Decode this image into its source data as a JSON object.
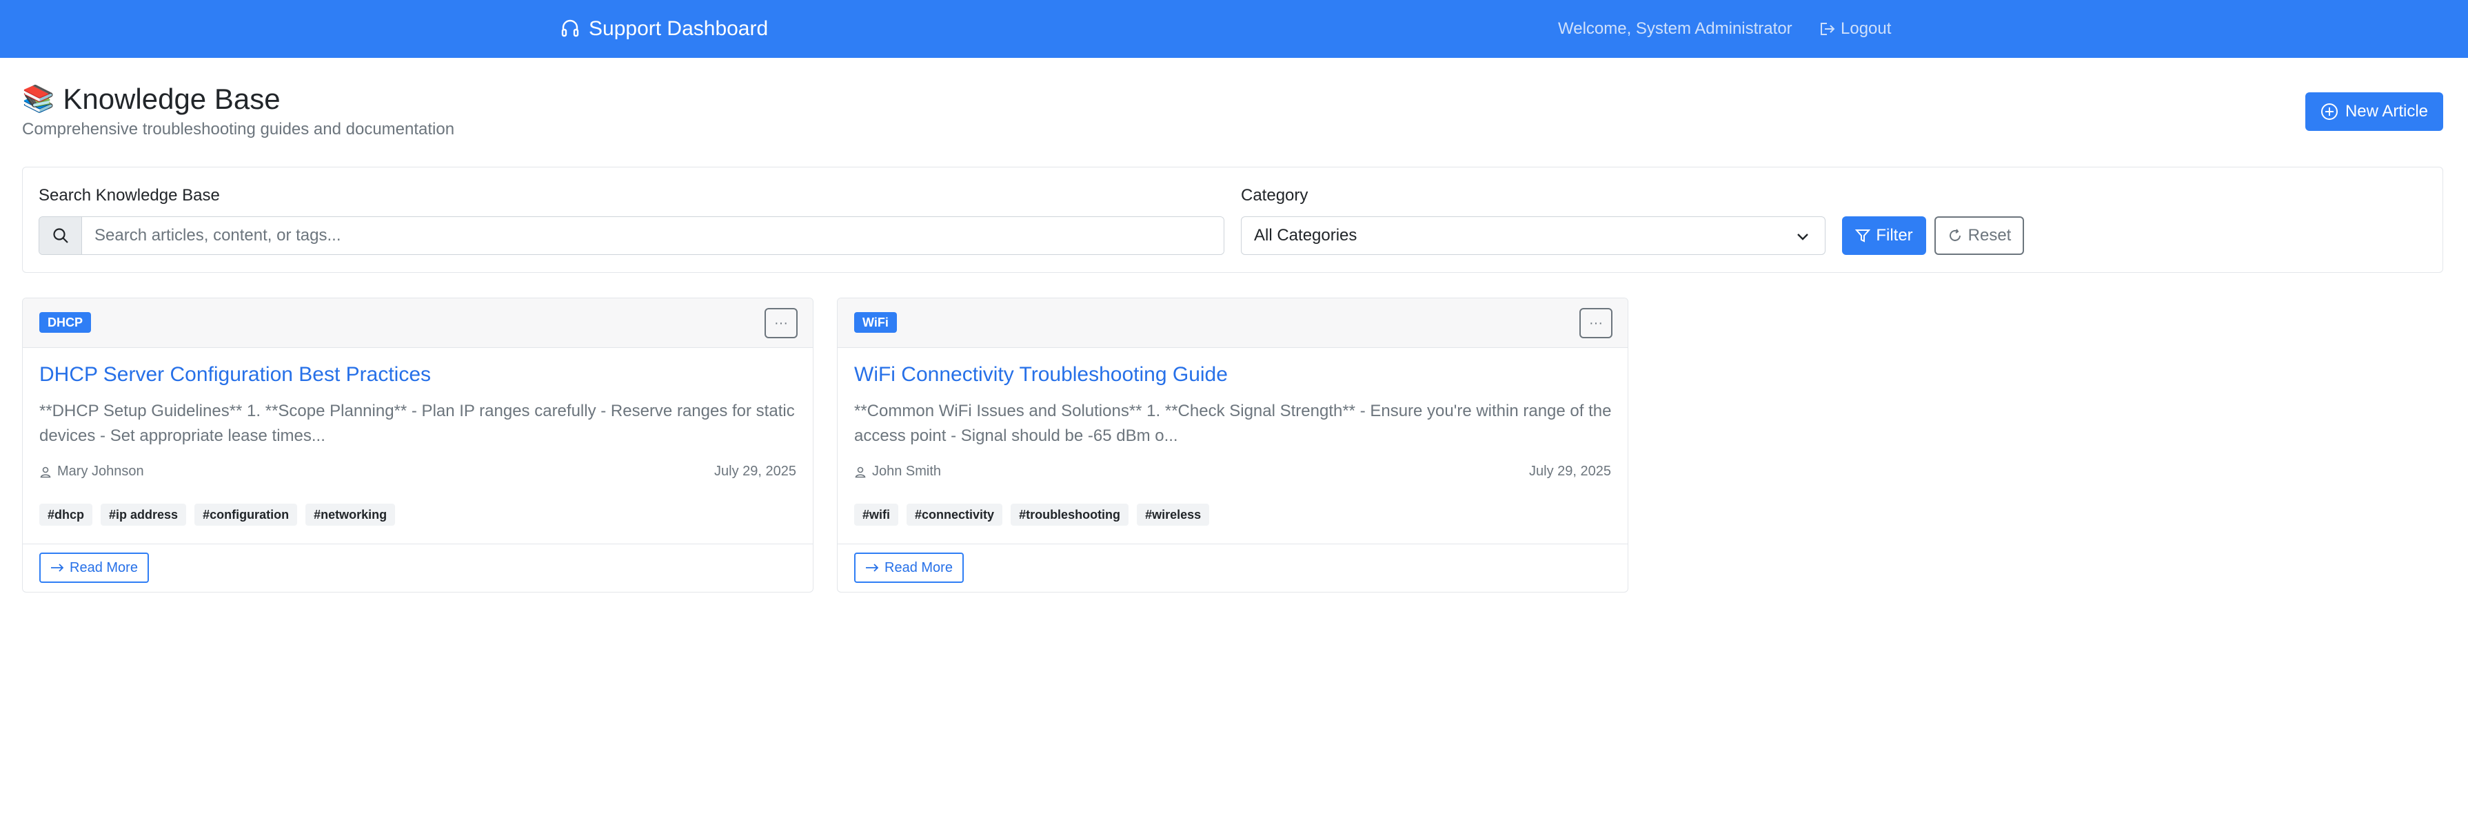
{
  "navbar": {
    "brand": "Support Dashboard",
    "brand_icon": "headset-icon",
    "welcome": "Welcome, System Administrator",
    "logout_label": "Logout"
  },
  "header": {
    "icon": "books-emoji",
    "title": "Knowledge Base",
    "subtitle": "Comprehensive troubleshooting guides and documentation",
    "new_article_label": "New Article"
  },
  "filters": {
    "search_label": "Search Knowledge Base",
    "search_placeholder": "Search articles, content, or tags...",
    "search_value": "",
    "category_label": "Category",
    "category_selected": "All Categories",
    "filter_label": "Filter",
    "reset_label": "Reset"
  },
  "articles": [
    {
      "category": "DHCP",
      "title": "DHCP Server Configuration Best Practices",
      "excerpt": "**DHCP Setup Guidelines** 1. **Scope Planning** - Plan IP ranges carefully - Reserve ranges for static devices - Set appropriate lease times...",
      "author": "Mary Johnson",
      "date": "July 29, 2025",
      "tags": [
        "#dhcp",
        "#ip address",
        "#configuration",
        "#networking"
      ],
      "read_more": "Read More"
    },
    {
      "category": "WiFi",
      "title": "WiFi Connectivity Troubleshooting Guide",
      "excerpt": "**Common WiFi Issues and Solutions** 1. **Check Signal Strength** - Ensure you're within range of the access point - Signal should be -65 dBm o...",
      "author": "John Smith",
      "date": "July 29, 2025",
      "tags": [
        "#wifi",
        "#connectivity",
        "#troubleshooting",
        "#wireless"
      ],
      "read_more": "Read More"
    }
  ],
  "colors": {
    "primary": "#2f7ef5",
    "link": "#2670e8",
    "muted": "#6c757d"
  }
}
